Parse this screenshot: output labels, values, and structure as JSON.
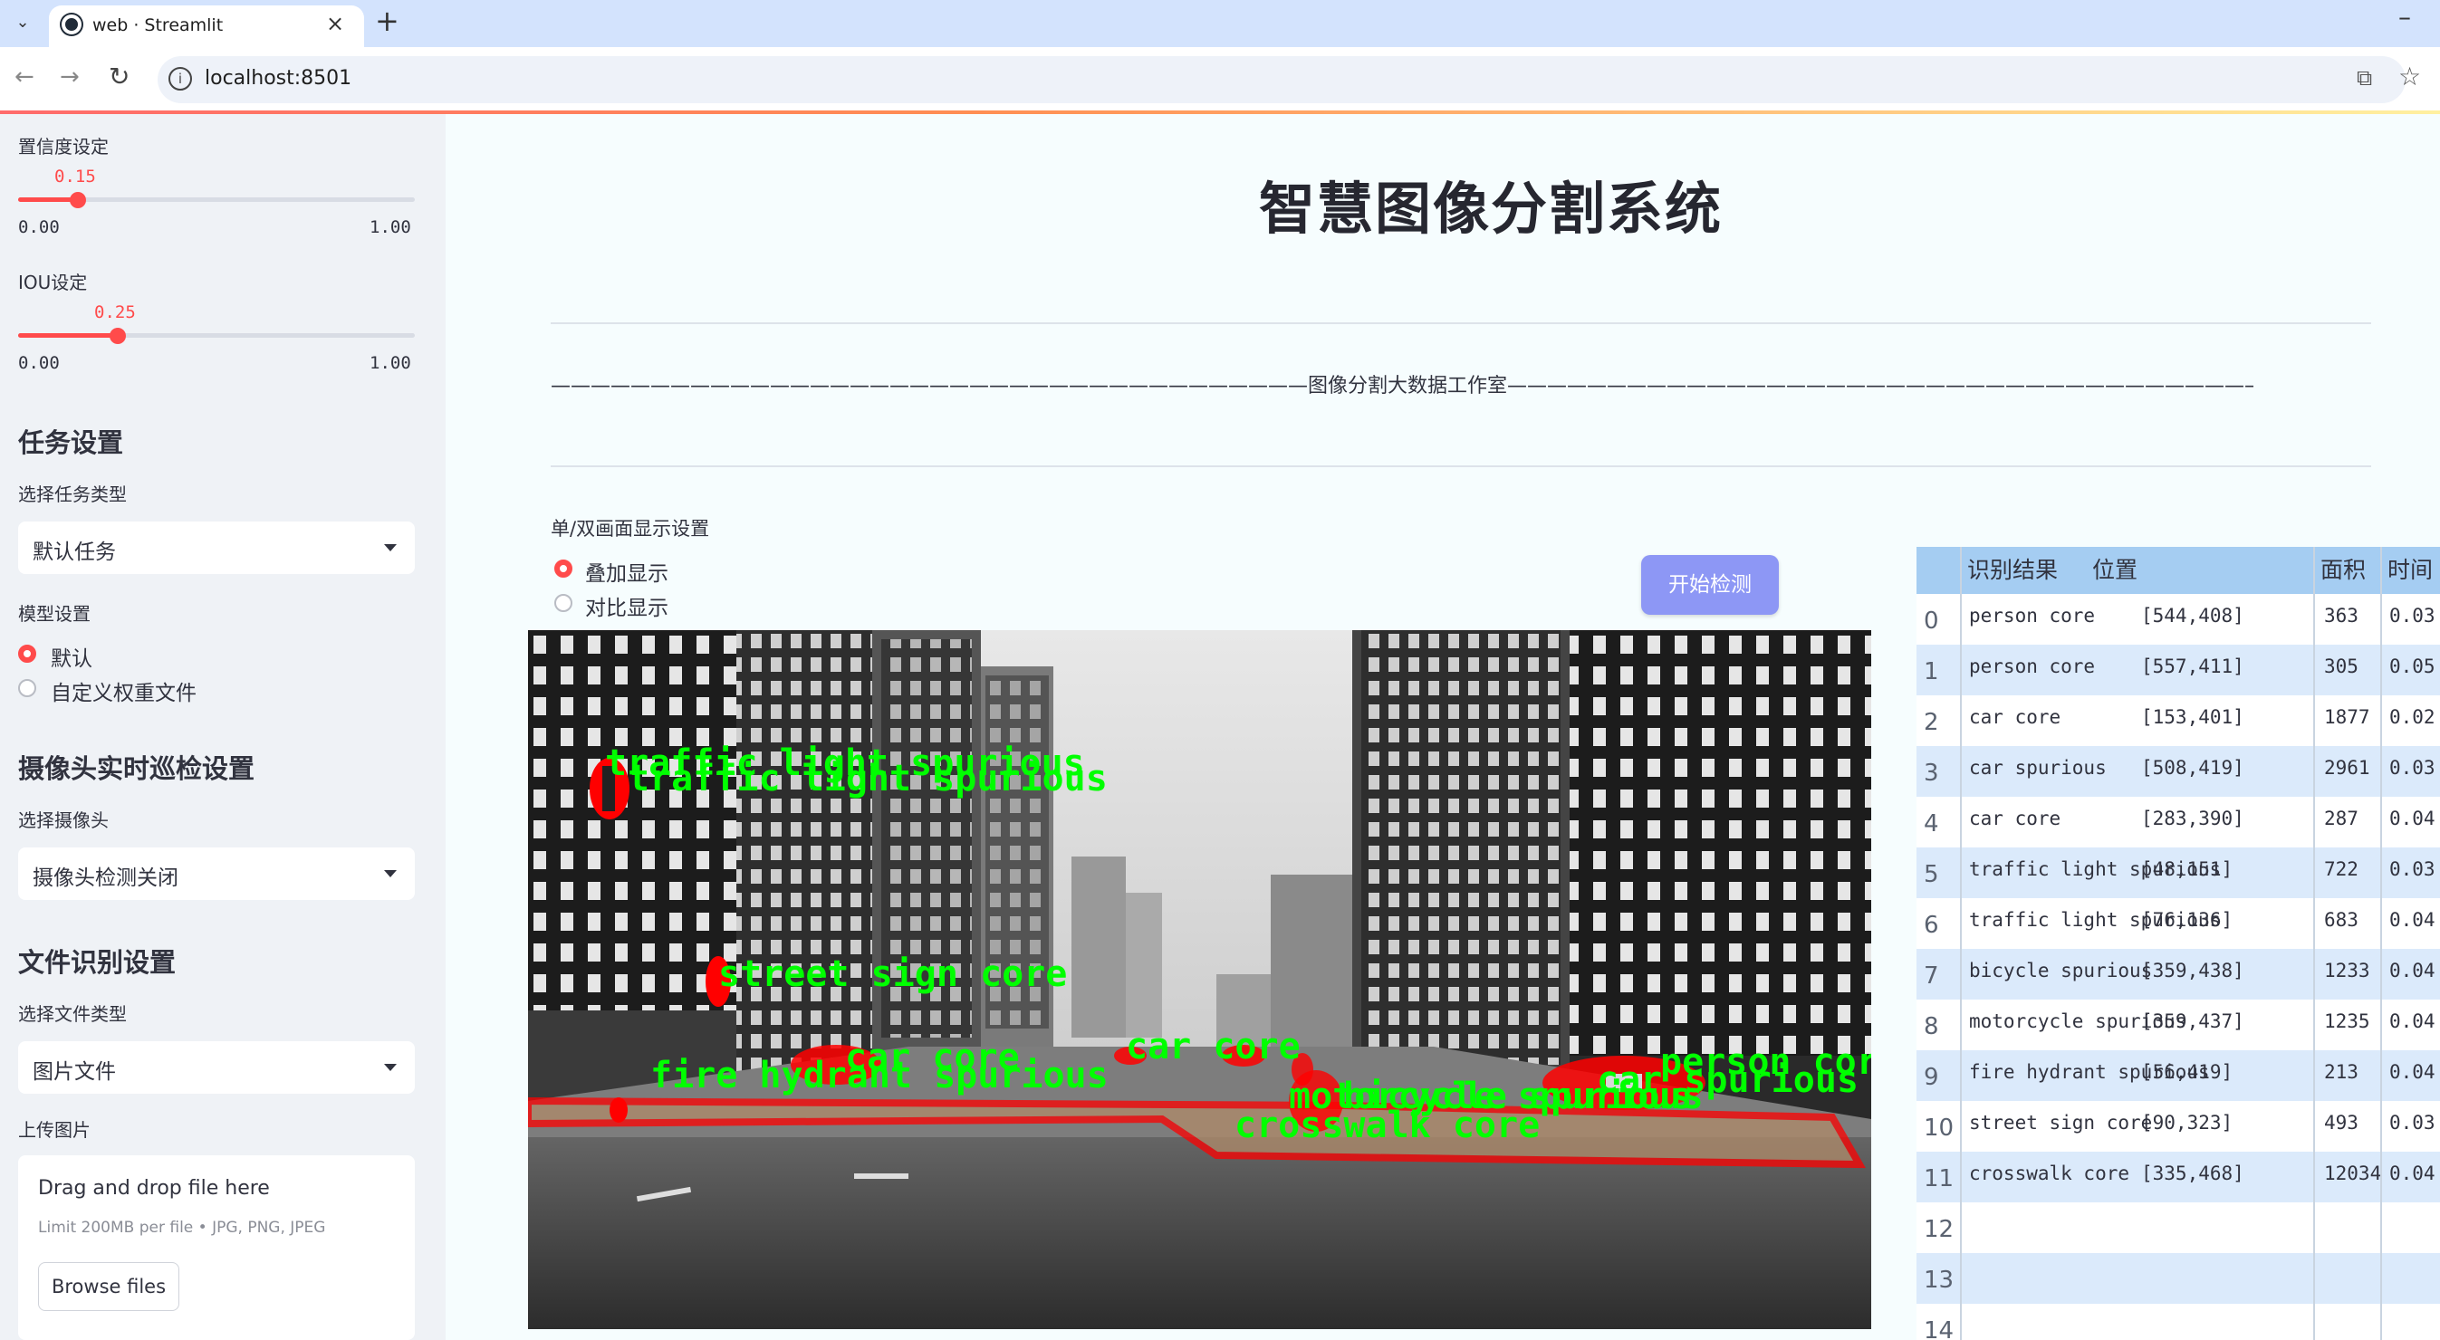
{
  "browser": {
    "tab_title": "web · Streamlit",
    "url": "localhost:8501"
  },
  "sidebar": {
    "confidence": {
      "label": "置信度设定",
      "value": "0.15",
      "min": "0.00",
      "max": "1.00",
      "fraction": 0.15
    },
    "iou": {
      "label": "IOU设定",
      "value": "0.25",
      "min": "0.00",
      "max": "1.00",
      "fraction": 0.25
    },
    "task": {
      "heading": "任务设置",
      "label": "选择任务类型",
      "selected": "默认任务"
    },
    "model": {
      "label": "模型设置",
      "options": [
        "默认",
        "自定义权重文件"
      ],
      "selected_index": 0
    },
    "camera": {
      "heading": "摄像头实时巡检设置",
      "label": "选择摄像头",
      "selected": "摄像头检测关闭"
    },
    "file": {
      "heading": "文件识别设置",
      "label": "选择文件类型",
      "selected": "图片文件"
    },
    "upload": {
      "label": "上传图片",
      "drop_text": "Drag and drop file here",
      "limit_text": "Limit 200MB per file • JPG, PNG, JPEG",
      "browse": "Browse files"
    }
  },
  "main": {
    "title": "智慧图像分割系统",
    "banner": "——————————————————————————————————————图像分割大数据工作室——————————————————————————————————————",
    "display_label": "单/双画面显示设置",
    "display_options": [
      "叠加显示",
      "对比显示"
    ],
    "display_selected": 0,
    "start_button": "开始检测"
  },
  "image_labels": [
    "traffic light spurious",
    "traffic light spurious",
    "street sign core",
    "car core",
    "car core",
    "fire hydrant spurious",
    "motorcycle spurious",
    "bicycle spurious",
    "crosswalk core",
    "car spurious",
    "person core"
  ],
  "table": {
    "headers": [
      "识别结果",
      "位置",
      "面积",
      "时间"
    ],
    "rows": [
      {
        "i": "0",
        "result": "person core",
        "pos": "[544,408]",
        "area": "363",
        "time": "0.03"
      },
      {
        "i": "1",
        "result": "person core",
        "pos": "[557,411]",
        "area": "305",
        "time": "0.05"
      },
      {
        "i": "2",
        "result": "car core",
        "pos": "[153,401]",
        "area": "1877",
        "time": "0.02"
      },
      {
        "i": "3",
        "result": "car spurious",
        "pos": "[508,419]",
        "area": "2961",
        "time": "0.03"
      },
      {
        "i": "4",
        "result": "car core",
        "pos": "[283,390]",
        "area": "287",
        "time": "0.04"
      },
      {
        "i": "5",
        "result": "traffic light spurious",
        "pos": "[48,151]",
        "area": "722",
        "time": "0.03"
      },
      {
        "i": "6",
        "result": "traffic light spurious",
        "pos": "[76,136]",
        "area": "683",
        "time": "0.04"
      },
      {
        "i": "7",
        "result": "bicycle spurious",
        "pos": "[359,438]",
        "area": "1233",
        "time": "0.04"
      },
      {
        "i": "8",
        "result": "motorcycle spurious",
        "pos": "[359,437]",
        "area": "1235",
        "time": "0.04"
      },
      {
        "i": "9",
        "result": "fire hydrant spurious",
        "pos": "[56,419]",
        "area": "213",
        "time": "0.04"
      },
      {
        "i": "10",
        "result": "street sign core",
        "pos": "[90,323]",
        "area": "493",
        "time": "0.03"
      },
      {
        "i": "11",
        "result": "crosswalk core",
        "pos": "[335,468]",
        "area": "12034",
        "time": "0.04"
      },
      {
        "i": "12",
        "result": "",
        "pos": "",
        "area": "",
        "time": ""
      },
      {
        "i": "13",
        "result": "",
        "pos": "",
        "area": "",
        "time": ""
      },
      {
        "i": "14",
        "result": "",
        "pos": "",
        "area": "",
        "time": ""
      }
    ]
  },
  "colors": {
    "accent": "#ff4b4b",
    "button": "#8d97f5",
    "table_header": "#a5cdf2",
    "table_alt": "#dbeafb",
    "label_green": "#00ff00",
    "mask_red": "#ff0000"
  }
}
